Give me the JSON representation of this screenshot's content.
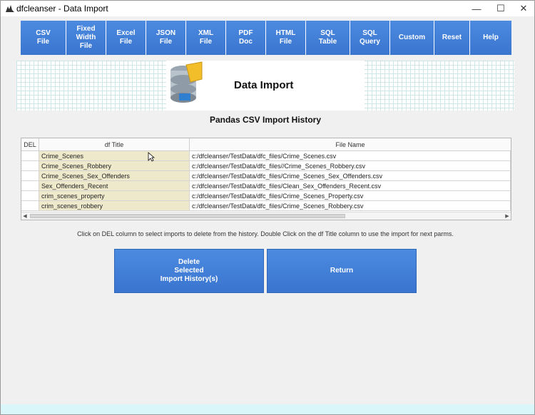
{
  "window": {
    "title": "dfcleanser - Data Import"
  },
  "nav": {
    "buttons": [
      {
        "label": "CSV\nFile"
      },
      {
        "label": "Fixed\nWidth\nFile"
      },
      {
        "label": "Excel\nFile"
      },
      {
        "label": "JSON\nFile"
      },
      {
        "label": "XML\nFile"
      },
      {
        "label": "PDF\nDoc"
      },
      {
        "label": "HTML\nFile"
      },
      {
        "label": "SQL\nTable"
      },
      {
        "label": "SQL\nQuery"
      },
      {
        "label": "Custom"
      },
      {
        "label": "Reset"
      },
      {
        "label": "Help"
      }
    ]
  },
  "banner": {
    "title": "Data Import"
  },
  "history": {
    "title": "Pandas CSV Import History",
    "columns": [
      "DEL",
      "df Title",
      "File Name"
    ],
    "rows": [
      {
        "del": "",
        "title": "Crime_Scenes",
        "file": "c:/dfcleanser/TestData/dfc_files/Crime_Scenes.csv"
      },
      {
        "del": "",
        "title": "Crime_Scenes_Robbery",
        "file": "c:/dfcleanser/TestData/dfc_files//Crime_Scenes_Robbery.csv"
      },
      {
        "del": "",
        "title": "Crime_Scenes_Sex_Offenders",
        "file": "c:/dfcleanser/TestData/dfc_files/Crime_Scenes_Sex_Offenders.csv"
      },
      {
        "del": "",
        "title": "Sex_Offenders_Recent",
        "file": "c:/dfcleanser/TestData/dfc_files/Clean_Sex_Offenders_Recent.csv"
      },
      {
        "del": "",
        "title": "crim_scenes_property",
        "file": "c:/dfcleanser/TestData/dfc_files/Crime_Scenes_Property.csv"
      },
      {
        "del": "",
        "title": "crim_scenes_robbery",
        "file": "c:/dfcleanser/TestData/dfc_files/Crime_Scenes_Robbery.csv"
      }
    ]
  },
  "hint": "Click on DEL column to select imports to delete from the history. Double Click on the df Title column to use the import for next parms.",
  "actions": {
    "delete_label": "Delete\nSelected\nImport History(s)",
    "return_label": "Return"
  },
  "colors": {
    "accent": "#3f7fd8",
    "title_cell_bg": "#efe9cc",
    "footer": "#d9f7fb"
  }
}
